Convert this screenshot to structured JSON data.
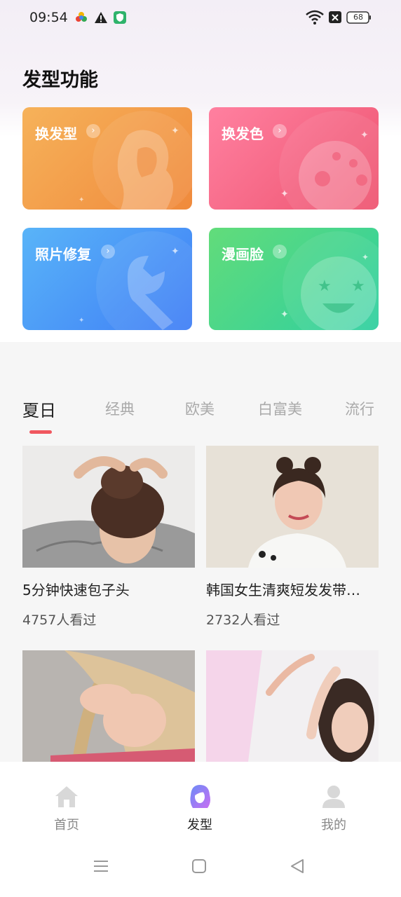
{
  "status_bar": {
    "time": "09:54",
    "battery": "68",
    "icons": [
      "app-color-icon",
      "warning-icon",
      "shield-icon",
      "wifi-icon",
      "no-sim-icon",
      "battery-icon"
    ]
  },
  "features": {
    "title": "发型功能",
    "cards": [
      {
        "label": "换发型",
        "icon": "hair-silhouette-icon"
      },
      {
        "label": "换发色",
        "icon": "palette-icon"
      },
      {
        "label": "照片修复",
        "icon": "wrench-icon"
      },
      {
        "label": "漫画脸",
        "icon": "cartoon-face-icon"
      }
    ],
    "arrow_icon": "chevron-right-icon"
  },
  "tabs": {
    "items": [
      "夏日",
      "经典",
      "欧美",
      "白富美",
      "流行"
    ],
    "active": "夏日"
  },
  "videos": [
    {
      "title": "5分钟快速包子头",
      "views": "4757人看过"
    },
    {
      "title": "韩国女生清爽短发发带…",
      "views": "2732人看过"
    },
    {
      "title": "",
      "views": ""
    },
    {
      "title": "",
      "views": ""
    }
  ],
  "bottom_nav": {
    "items": [
      {
        "label": "首页",
        "icon": "home-icon"
      },
      {
        "label": "发型",
        "icon": "hairstyle-icon"
      },
      {
        "label": "我的",
        "icon": "profile-icon"
      }
    ],
    "active": "发型"
  },
  "system_nav": [
    "menu-icon",
    "home-square-icon",
    "back-triangle-icon"
  ],
  "colors": {
    "accent": "#f0575f",
    "card_orange": "#f49a4a",
    "card_pink": "#f06080",
    "card_blue": "#4d9cf8",
    "card_green": "#3fd59a"
  }
}
